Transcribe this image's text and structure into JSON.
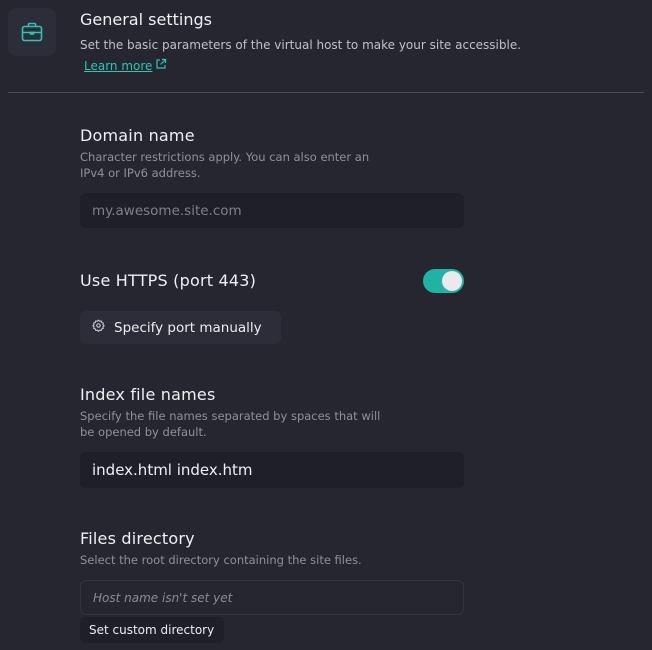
{
  "header": {
    "title": "General settings",
    "description": "Set the basic parameters of the virtual host to make your site accessible.",
    "learn_more": "Learn more",
    "icon": "briefcase-icon"
  },
  "domain": {
    "title": "Domain name",
    "description_line1": "Character restrictions apply. You can also enter an",
    "description_line2": "IPv4 or IPv6 address.",
    "placeholder": "my.awesome.site.com",
    "value": ""
  },
  "https": {
    "label": "Use HTTPS (port 443)",
    "enabled": true,
    "port_button": "Specify port manually",
    "port_icon": "gear-icon"
  },
  "index_files": {
    "title": "Index file names",
    "description_line1": "Specify the file names separated by spaces that will",
    "description_line2": "be opened by default.",
    "value": "index.html index.htm"
  },
  "files_directory": {
    "title": "Files directory",
    "description": "Select the root directory containing the site files.",
    "placeholder": "Host name isn't set yet",
    "custom_button": "Set custom directory"
  },
  "colors": {
    "background": "#262631",
    "accent": "#2ec4b6",
    "toggle_on": "#20b3a4",
    "input_bg": "#1f1f29"
  }
}
